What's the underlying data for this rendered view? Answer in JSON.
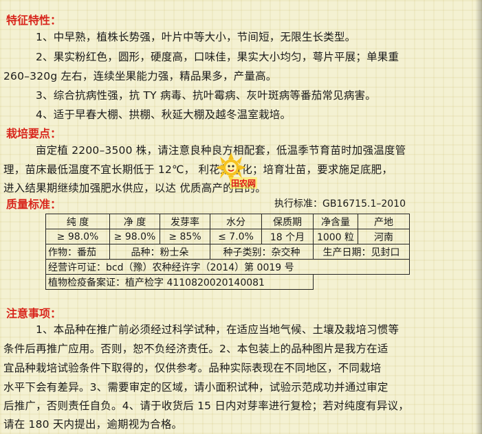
{
  "features": {
    "heading": "特征特性：",
    "lines": [
      "1、中早熟，植株长势强，叶片中等大小，节间短，无限生长类型。",
      "2、果实粉红色，圆形，硬度高，口味佳，果实大小均匀，萼片平展；单果重",
      "260–320g 左右，连续坐果能力强，精品果多，产量高。",
      "3、综合抗病性强，抗 TY 病毒、抗叶霉病、灰叶斑病等番茄常见病害。",
      "4、适于早春大棚、拱棚、秋延大棚及越冬温室栽培。"
    ]
  },
  "cultivation": {
    "heading": "栽培要点：",
    "lines": [
      "亩定植 2200–3500 株，请注意良种良方相配套，低温季节育苗时加强温度管",
      "理，苗床最低温度不宜长期低于 12℃，     利花芽分化；培育壮苗，要求施足底肥，",
      "进入结果期继续加强肥水供应，以达     优质高产的目的。"
    ]
  },
  "watermark": {
    "text": "田农网"
  },
  "quality": {
    "heading": "质量标准：",
    "standard": "执行标准：GB16715.1–2010",
    "headers": [
      "纯  度",
      "净  度",
      "发芽率",
      "水分",
      "保质期",
      "净含量",
      "产地"
    ],
    "values": [
      "≥ 98.0%",
      "≥ 98.0%",
      "≥ 85%",
      "≤ 7.0%",
      "18 个月",
      "1000 粒",
      "河南"
    ],
    "crop": "作物：番茄",
    "variety": "品种：粉士朵",
    "seed_type": "种子类别：杂交种",
    "production_date": "生产日期：见封口",
    "license": "经营许可证：bcd（豫）农种经许字（2014）第 0019 号",
    "quarantine": "植物检疫备案证：植产检字 4110820020140081"
  },
  "notes": {
    "heading": "注意事项：",
    "lines": [
      "1、本品种在推广前必须经过科学试种，在适应当地气候、土壤及栽培习惯等",
      "条件后再推广应用。否则，恕不负经济责任。2、本包装上的品种图片是我方在适",
      "宜品种栽培试验条件下取得的，仅供参考。品种实际表现在不同地区，不同栽培",
      "水平下会有差异。3、需要审定的区域，请小面积试种，试验示范成功并通过审定",
      "后推广，否则责任自负。4、请于收货后 15 日内对芽率进行复检；若对纯度有异议，",
      "请在 180 天内提出，逾期视为合格。"
    ]
  }
}
